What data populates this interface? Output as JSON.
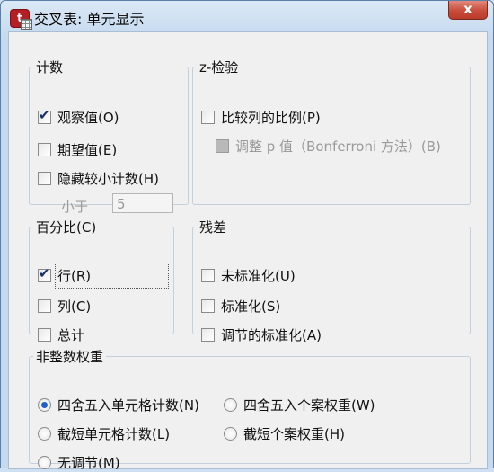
{
  "window": {
    "title": "交叉表: 单元显示",
    "close_label": "x"
  },
  "counts": {
    "legend": "计数",
    "observed": "观察值(O)",
    "expected": "期望值(E)",
    "hide_small": "隐藏较小计数(H)",
    "less_than_label": "小于",
    "less_than_value": "5"
  },
  "z_test": {
    "legend": "z-检验",
    "compare_columns": "比较列的比例(P)",
    "bonferroni": "调整 p 值（Bonferroni 方法）(B)"
  },
  "percentages": {
    "legend": "百分比(C)",
    "row": "行(R)",
    "column": "列(C)",
    "total": "总计"
  },
  "residuals": {
    "legend": "残差",
    "unstandardized": "未标准化(U)",
    "standardized": "标准化(S)",
    "adjusted": "调节的标准化(A)"
  },
  "noninteger": {
    "legend": "非整数权重",
    "round_cell": "四舍五入单元格计数(N)",
    "round_case": "四舍五入个案权重(W)",
    "truncate_cell": "截短单元格计数(L)",
    "truncate_case": "截短个案权重(H)",
    "no_adjust": "无调节(M)"
  },
  "state": {
    "observed_checked": true,
    "row_checked": true,
    "selected_noninteger": "round_cell"
  }
}
